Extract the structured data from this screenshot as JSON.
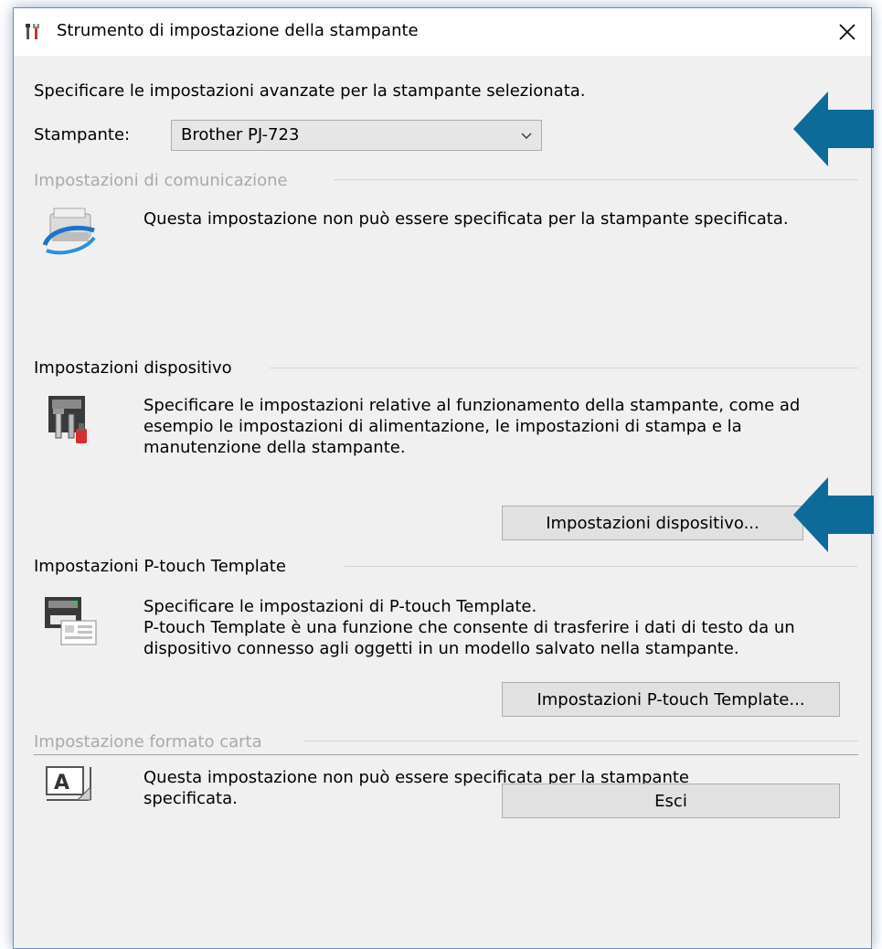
{
  "window": {
    "title": "Strumento di impostazione della stampante"
  },
  "intro_text": "Specificare le impostazioni avanzate per la stampante selezionata.",
  "printer": {
    "label": "Stampante:",
    "selected": "Brother PJ-723"
  },
  "sections": {
    "communication": {
      "header": "Impostazioni di comunicazione",
      "description": [
        "Questa impostazione non può essere specificata per la stampante specificata."
      ],
      "enabled": false,
      "icon": "network-printer-icon"
    },
    "device": {
      "header": "Impostazioni dispositivo",
      "description": [
        "Specificare le impostazioni relative al funzionamento della stampante, come ad",
        "esempio le impostazioni di alimentazione, le impostazioni di stampa e la",
        "manutenzione della stampante."
      ],
      "button_label": "Impostazioni dispositivo...",
      "enabled": true,
      "icon": "printer-tools-icon"
    },
    "ptouch": {
      "header": "Impostazioni P-touch Template",
      "description": [
        "Specificare le impostazioni di P-touch Template.",
        "P-touch Template è una funzione che consente di trasferire i dati di testo da un",
        "dispositivo connesso agli oggetti in un modello salvato nella stampante."
      ],
      "button_label": "Impostazioni P-touch Template...",
      "enabled": true,
      "icon": "printer-template-icon"
    },
    "paper": {
      "header": "Impostazione formato carta",
      "description": [
        "Questa impostazione non può essere specificata per la stampante",
        "specificata."
      ],
      "enabled": false,
      "icon": "paper-size-icon"
    }
  },
  "exit_label": "Esci",
  "colors": {
    "arrow": "#0e6b99",
    "disabled_text": "#a9a9a9",
    "window_bg": "#f0f0f0"
  }
}
